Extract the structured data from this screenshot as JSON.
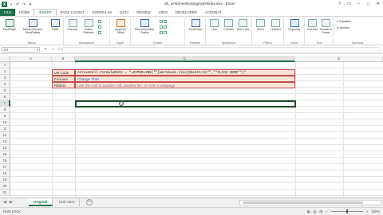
{
  "window": {
    "title": "36_LinkSheetsUsingHyperlinks.xlsx - Excel"
  },
  "tabs": [
    "FILE",
    "HOME",
    "INSERT",
    "PAGE LAYOUT",
    "FORMULAS",
    "DATA",
    "REVIEW",
    "VIEW",
    "DEVELOPER",
    "ACROBAT"
  ],
  "active_tab": "INSERT",
  "ribbon": {
    "groups": {
      "tables": "Tables",
      "illustrations": "Illustrations",
      "apps": "Apps",
      "charts": "Charts",
      "reports": "Reports",
      "sparklines": "Sparklines",
      "filters": "Filters",
      "links": "Links",
      "text": "Text",
      "symbols": "Symbols"
    },
    "buttons": {
      "pivot_table": "PivotTable",
      "recommended_pivot": "Recommended PivotTables",
      "table": "Table",
      "pictures": "Pictures",
      "online_pictures": "Online Pictures",
      "apps_for_office": "Apps for Office",
      "recommended_charts": "Recommended Charts",
      "pivot_chart": "PivotChart",
      "line": "Line",
      "column": "Column",
      "win_loss": "Win/ Loss",
      "slicer": "Slicer",
      "timeline": "Timeline",
      "hyperlink": "Hyperlink",
      "text_box": "Text Box",
      "header_footer": "Header & Footer",
      "equation": "Equation",
      "symbol": "Symbol"
    }
  },
  "formula_bar": {
    "name_box": "C7",
    "fx": "fx",
    "formula": ""
  },
  "grid": {
    "columns": [
      "A",
      "B",
      "C",
      "D"
    ],
    "rows": [
      "1",
      "2",
      "3",
      "4",
      "5",
      "6",
      "7",
      "8",
      "9",
      "10",
      "11",
      "12",
      "13",
      "14",
      "15",
      "16",
      "17",
      "18",
      "19",
      "20",
      "21"
    ],
    "cells": {
      "b3": "VB Code",
      "c3": "ActiveCell.FormulaR1C1 = \"=HYPERLINK(\"\"[Workbook.xlsx]Sheet1!A1\"\",\"\"CLICK HERE\"\")\"",
      "b4": "Formula",
      "c4": "Change This!",
      "b5": "Ribbon",
      "c5": "Link the Cell to another cell, another file, or even a webpage"
    }
  },
  "sheets": [
    "Original",
    "Unit Here"
  ],
  "active_sheet": "Original",
  "status": {
    "left": "NUM LOCK",
    "zoom": "100%"
  },
  "colors": {
    "excel_green": "#1e7145",
    "label_fill": "#fce4d6",
    "label_border": "#c0504d",
    "link_blue": "#3355cc"
  }
}
